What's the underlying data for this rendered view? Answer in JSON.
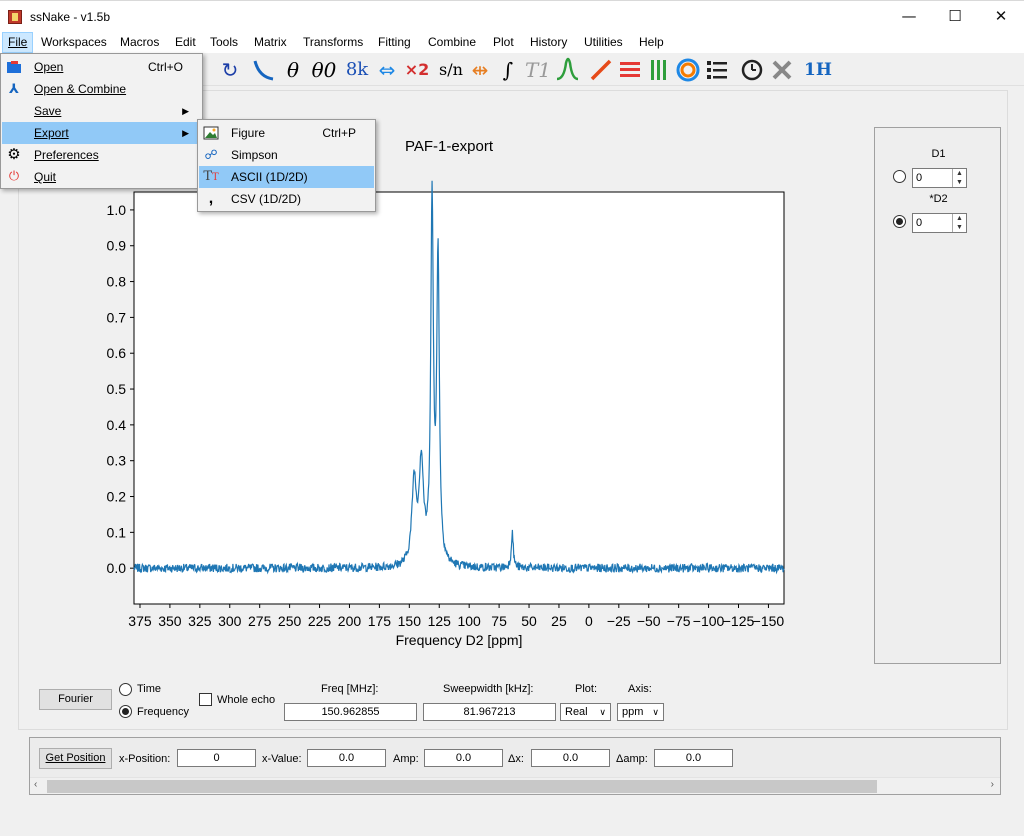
{
  "window": {
    "title": "ssNake - v1.5b",
    "minimize": "—",
    "maximize": "☐",
    "close": "✕"
  },
  "menubar": [
    {
      "label": "File"
    },
    {
      "label": "Workspaces"
    },
    {
      "label": "Macros"
    },
    {
      "label": "Edit"
    },
    {
      "label": "Tools"
    },
    {
      "label": "Matrix"
    },
    {
      "label": "Transforms"
    },
    {
      "label": "Fitting"
    },
    {
      "label": "Combine"
    },
    {
      "label": "Plot"
    },
    {
      "label": "History"
    },
    {
      "label": "Utilities"
    },
    {
      "label": "Help"
    }
  ],
  "toolbar": {
    "theta": "θ",
    "theta0": "θ0",
    "eightk": "8k",
    "x2": "×2",
    "sn": "s/n",
    "integral": "∫",
    "t1": "T1",
    "oneh": "1H"
  },
  "file_menu": [
    {
      "label": "Open",
      "shortcut": "Ctrl+O",
      "icon": "folder-icon"
    },
    {
      "label": "Open & Combine",
      "shortcut": "",
      "icon": "combine-icon"
    },
    {
      "label": "Save",
      "shortcut": "",
      "icon": "",
      "submenu": true
    },
    {
      "label": "Export",
      "shortcut": "",
      "icon": "",
      "submenu": true
    },
    {
      "label": "Preferences",
      "shortcut": "",
      "icon": "gear-icon"
    },
    {
      "label": "Quit",
      "shortcut": "",
      "icon": "power-icon"
    }
  ],
  "export_menu": [
    {
      "label": "Figure",
      "shortcut": "Ctrl+P",
      "icon": "image-icon"
    },
    {
      "label": "Simpson",
      "shortcut": "",
      "icon": "simpson-icon"
    },
    {
      "label": "ASCII (1D/2D)",
      "shortcut": "",
      "icon": "text-icon"
    },
    {
      "label": "CSV (1D/2D)",
      "shortcut": "",
      "icon": "comma-icon"
    }
  ],
  "side_panel": {
    "d1_label": "D1",
    "d1_value": "0",
    "d2_label": "*D2",
    "d2_value": "0"
  },
  "controls": {
    "fourier": "Fourier",
    "time": "Time",
    "frequency": "Frequency",
    "whole_echo": "Whole echo",
    "freq_label": "Freq [MHz]:",
    "freq_value": "150.962855",
    "sw_label": "Sweepwidth [kHz]:",
    "sw_value": "81.967213",
    "plot_label": "Plot:",
    "plot_value": "Real",
    "axis_label": "Axis:",
    "axis_value": "ppm"
  },
  "position": {
    "get_position": "Get Position",
    "xpos_label": "x-Position:",
    "xpos_value": "0",
    "xval_label": "x-Value:",
    "xval_value": "0.0",
    "amp_label": "Amp:",
    "amp_value": "0.0",
    "dx_label": "Δx:",
    "dx_value": "0.0",
    "damp_label": "Δamp:",
    "damp_value": "0.0"
  },
  "chart_data": {
    "type": "line",
    "title": "PAF-1-export",
    "xlabel": "Frequency D2 [ppm]",
    "ylabel": "",
    "xlim": [
      380,
      -163
    ],
    "ylim": [
      -0.1,
      1.05
    ],
    "x_ticks": [
      375,
      350,
      325,
      300,
      275,
      250,
      225,
      200,
      175,
      150,
      125,
      100,
      75,
      50,
      25,
      0,
      -25,
      -50,
      -75,
      -100,
      -125,
      -150
    ],
    "y_ticks": [
      0.0,
      0.1,
      0.2,
      0.3,
      0.4,
      0.5,
      0.6,
      0.7,
      0.8,
      0.9,
      1.0
    ],
    "line_color": "#1f77b4",
    "grid": false,
    "peaks": [
      {
        "x": 146,
        "y": 0.23
      },
      {
        "x": 140,
        "y": 0.28
      },
      {
        "x": 131,
        "y": 1.0
      },
      {
        "x": 126,
        "y": 0.85
      },
      {
        "x": 64,
        "y": 0.1
      }
    ],
    "baseline": 0.0,
    "noise_amplitude": 0.012
  }
}
